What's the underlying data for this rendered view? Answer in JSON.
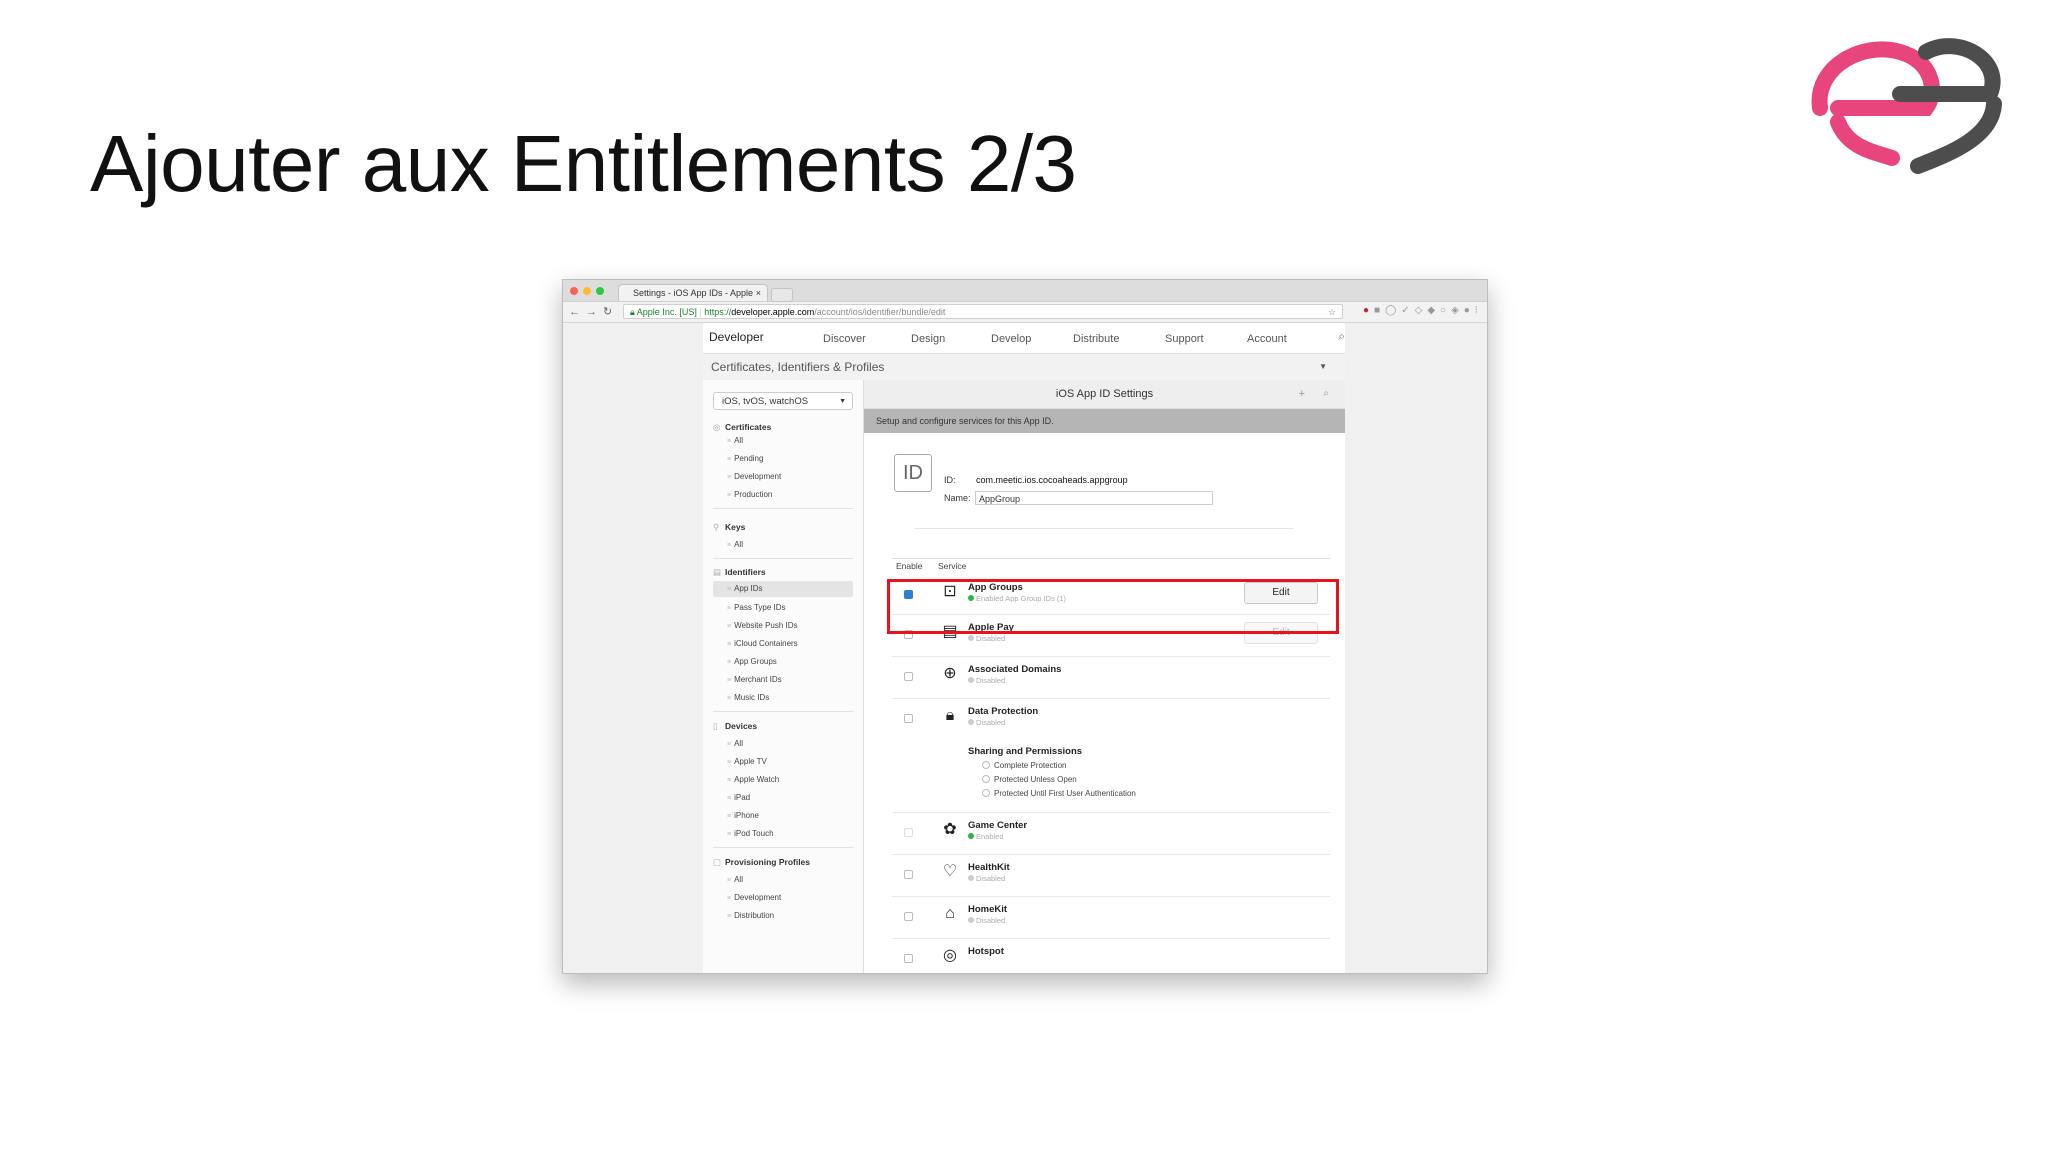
{
  "slide": {
    "title": "Ajouter aux Entitlements 2/3"
  },
  "colors": {
    "logo_pink": "#e8457d",
    "logo_grey": "#4d4d4d",
    "highlight_red": "#e8131b",
    "enabled_green": "#2fb34a"
  },
  "browser": {
    "tab_title": "Settings - iOS App IDs - Apple",
    "url_secure": "Apple Inc. [US]",
    "url_scheme": "https://",
    "url_host": "developer.apple.com",
    "url_path": "/account/ios/identifier/bundle/edit"
  },
  "topnav": {
    "brand": "Developer",
    "items": [
      "Discover",
      "Design",
      "Develop",
      "Distribute",
      "Support",
      "Account"
    ]
  },
  "section_title": "Certificates, Identifiers & Profiles",
  "sidebar": {
    "platform": "iOS, tvOS, watchOS",
    "groups": [
      {
        "title": "Certificates",
        "items": [
          "All",
          "Pending",
          "Development",
          "Production"
        ]
      },
      {
        "title": "Keys",
        "items": [
          "All"
        ]
      },
      {
        "title": "Identifiers",
        "items": [
          "App IDs",
          "Pass Type IDs",
          "Website Push IDs",
          "iCloud Containers",
          "App Groups",
          "Merchant IDs",
          "Music IDs"
        ]
      },
      {
        "title": "Devices",
        "items": [
          "All",
          "Apple TV",
          "Apple Watch",
          "iPad",
          "iPhone",
          "iPod Touch"
        ]
      },
      {
        "title": "Provisioning Profiles",
        "items": [
          "All",
          "Development",
          "Distribution"
        ]
      }
    ]
  },
  "main": {
    "header": "iOS App ID Settings",
    "setup_text": "Setup and configure services for this App ID.",
    "id_badge": "ID",
    "id_label": "ID:",
    "id_value": "com.meetic.ios.cocoaheads.appgroup",
    "name_label": "Name:",
    "name_value": "AppGroup",
    "col_enable": "Enable",
    "col_service": "Service",
    "edit_label": "Edit",
    "services": [
      {
        "name": "App Groups",
        "status": "Enabled App Group IDs (1)",
        "enabled": true,
        "icon": "app-groups-icon"
      },
      {
        "name": "Apple Pay",
        "status": "Disabled",
        "enabled": false,
        "icon": "apple-pay-icon"
      },
      {
        "name": "Associated Domains",
        "status": "Disabled",
        "enabled": false,
        "icon": "globe-icon"
      },
      {
        "name": "Data Protection",
        "status": "Disabled",
        "enabled": false,
        "icon": "lock-icon"
      },
      {
        "name": "Game Center",
        "status": "Enabled",
        "enabled": true,
        "icon": "game-center-icon"
      },
      {
        "name": "HealthKit",
        "status": "Disabled",
        "enabled": false,
        "icon": "healthkit-icon"
      },
      {
        "name": "HomeKit",
        "status": "Disabled",
        "enabled": false,
        "icon": "homekit-icon"
      },
      {
        "name": "Hotspot",
        "status": "",
        "enabled": false,
        "icon": "hotspot-icon"
      }
    ],
    "sharing": {
      "title": "Sharing and Permissions",
      "options": [
        "Complete Protection",
        "Protected Unless Open",
        "Protected Until First User Authentication"
      ]
    }
  }
}
